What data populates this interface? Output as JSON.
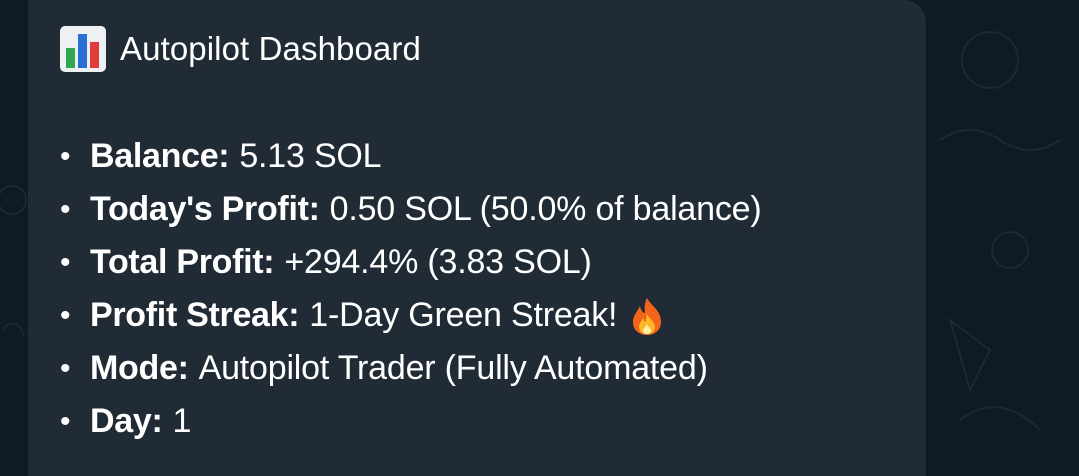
{
  "message": {
    "title": "Autopilot Dashboard",
    "title_icon": "bar-chart-icon",
    "items": [
      {
        "bullet": "•",
        "label": "Balance:",
        "value": "5.13 SOL"
      },
      {
        "bullet": "•",
        "label": "Today's Profit:",
        "value": "0.50 SOL (50.0% of balance)"
      },
      {
        "bullet": "•",
        "label": "Total Profit:",
        "value": "+294.4% (3.83 SOL)"
      },
      {
        "bullet": "•",
        "label": "Profit Streak:",
        "value": "1-Day Green Streak!",
        "icon": "fire-icon"
      },
      {
        "bullet": "•",
        "label": "Mode:",
        "value": "Autopilot Trader (Fully Automated)"
      },
      {
        "bullet": "•",
        "label": "Day:",
        "value": "1"
      }
    ]
  },
  "colors": {
    "chat_background": "#0f1a23",
    "bubble_background": "#212b35",
    "text": "#ffffff"
  }
}
